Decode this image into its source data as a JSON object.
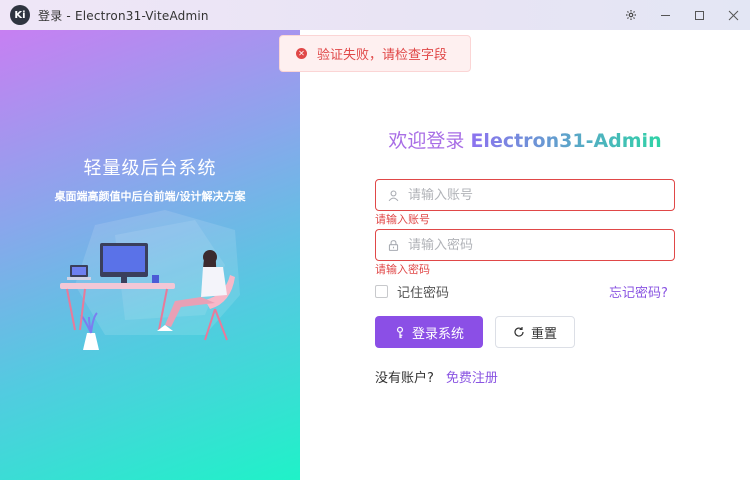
{
  "window": {
    "title": "登录 - Electron31-ViteAdmin",
    "logo_text": "Ki"
  },
  "left": {
    "title": "轻量级后台系统",
    "subtitle": "桌面端高颜值中后台前端/设计解决方案"
  },
  "login": {
    "title_prefix": "欢迎登录",
    "title_app": "Electron31-Admin",
    "username": {
      "placeholder": "请输入账号",
      "value": "",
      "error": "请输入账号"
    },
    "password": {
      "placeholder": "请输入密码",
      "value": "",
      "error": "请输入密码"
    },
    "remember_label": "记住密码",
    "remember_checked": false,
    "forgot_label": "忘记密码?",
    "login_button": "登录系统",
    "reset_button": "重置",
    "no_account": "没有账户?",
    "register_link": "免费注册"
  },
  "toast": {
    "message": "验证失败，请检查字段",
    "type": "error"
  },
  "colors": {
    "accent": "#8b4fe6",
    "error": "#e04848",
    "gradient_top": "#c77ff2",
    "gradient_bottom": "#1ff2c8"
  },
  "icons": {
    "user": "user-icon",
    "lock": "lock-icon",
    "key": "key-icon",
    "refresh": "refresh-icon",
    "settings": "gear-icon",
    "error": "error-circle-icon"
  }
}
